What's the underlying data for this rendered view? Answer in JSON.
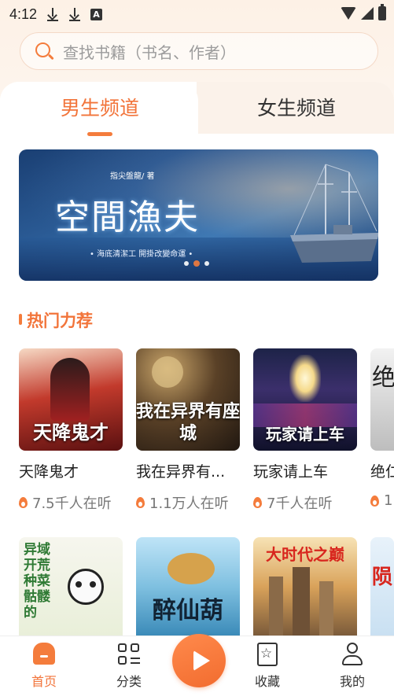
{
  "status_bar": {
    "time": "4:12",
    "icon_a": "A"
  },
  "search": {
    "placeholder": "查找书籍（书名、作者）"
  },
  "tabs": [
    {
      "label": "男生频道",
      "active": true
    },
    {
      "label": "女生频道",
      "active": false
    }
  ],
  "banner": {
    "author": "指尖盤龍/ 著",
    "title": "空間漁夫",
    "slogan": "• 海底清潔工 開掛改變命運 •",
    "dots": 3,
    "active_dot": 1
  },
  "section": {
    "title": "热门力荐"
  },
  "books": [
    {
      "name": "天降鬼才",
      "listeners": "7.5千人在听",
      "cover_text": "天降鬼才"
    },
    {
      "name": "我在异界有...",
      "listeners": "1.1万人在听",
      "cover_text": "我在异界有座城"
    },
    {
      "name": "玩家请上车",
      "listeners": "7千人在听",
      "cover_text": "玩家请上车"
    },
    {
      "name": "绝仁",
      "listeners": "1",
      "cover_text": "绝"
    }
  ],
  "books_row2": [
    {
      "cover_text": "异域开荒 种菜骷髅的"
    },
    {
      "cover_text": "醉仙葫"
    },
    {
      "cover_text": "大时代之巅"
    },
    {
      "cover_text": "陨"
    }
  ],
  "nav": [
    {
      "label": "首页",
      "icon": "home-icon",
      "active": true
    },
    {
      "label": "分类",
      "icon": "category-icon",
      "active": false
    },
    {
      "label": "收藏",
      "icon": "favorite-icon",
      "active": false
    },
    {
      "label": "我的",
      "icon": "profile-icon",
      "active": false
    }
  ],
  "colors": {
    "accent": "#f47c3c",
    "text": "#222222",
    "muted": "#777777"
  }
}
